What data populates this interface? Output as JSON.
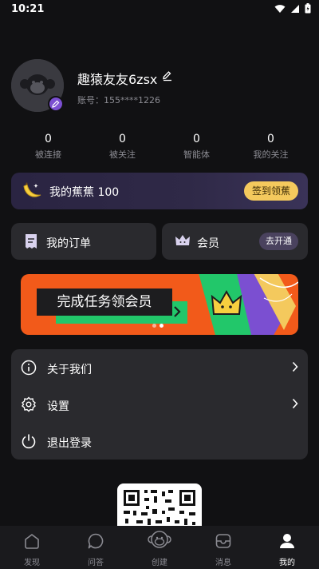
{
  "status_bar": {
    "time": "10:21"
  },
  "profile": {
    "username": "趣猿友友6zsx",
    "account": "账号：155****1226"
  },
  "stats": [
    {
      "value": "0",
      "label": "被连接"
    },
    {
      "value": "0",
      "label": "被关注"
    },
    {
      "value": "0",
      "label": "智能体"
    },
    {
      "value": "0",
      "label": "我的关注"
    }
  ],
  "banana": {
    "label": "我的蕉蕉 100",
    "signin_label": "签到领蕉"
  },
  "cards": {
    "orders_label": "我的订单",
    "vip_label": "会员",
    "vip_open_label": "去开通"
  },
  "promo": {
    "text": "完成任务领会员",
    "page_count": 2,
    "active_page": 2
  },
  "menu": {
    "items": [
      {
        "label": "关于我们",
        "icon": "info-icon"
      },
      {
        "label": "设置",
        "icon": "gear-icon"
      },
      {
        "label": "退出登录",
        "icon": "power-icon"
      }
    ]
  },
  "tabbar": {
    "tabs": [
      {
        "label": "发现",
        "icon": "discover-icon"
      },
      {
        "label": "问答",
        "icon": "chat-bubble-icon"
      },
      {
        "label": "创建",
        "icon": "monkey-create-icon"
      },
      {
        "label": "消息",
        "icon": "message-box-icon"
      },
      {
        "label": "我的",
        "icon": "person-icon"
      }
    ],
    "active": "我的"
  },
  "colors": {
    "background": "#111113",
    "card": "#2a2a2e",
    "accent_gold": "#f4c95d",
    "accent_purple": "#7b4fd1",
    "promo_orange": "#f25a1a",
    "promo_green": "#22c76a"
  }
}
